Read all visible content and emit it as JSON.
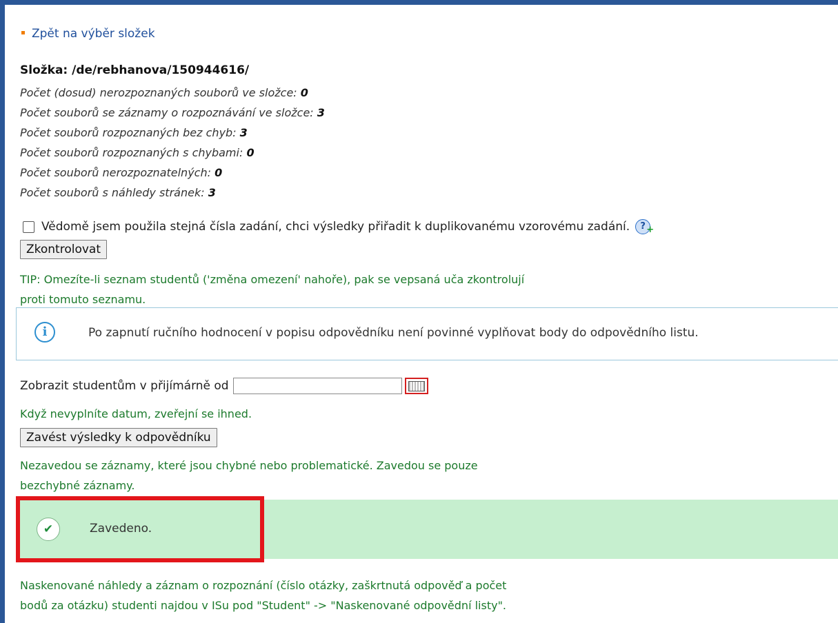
{
  "nav": {
    "back_label": "Zpět na výběr složek"
  },
  "folder": {
    "title": "Složka: /de/rebhanova/150944616/",
    "stats": [
      {
        "label": "Počet (dosud) nerozpoznaných souborů ve složce: ",
        "value": "0"
      },
      {
        "label": "Počet souborů se záznamy o rozpoznávání ve složce: ",
        "value": "3"
      },
      {
        "label": "Počet souborů rozpoznaných bez chyb: ",
        "value": "3"
      },
      {
        "label": "Počet souborů rozpoznaných s chybami: ",
        "value": "0"
      },
      {
        "label": "Počet souborů nerozpoznatelných: ",
        "value": "0"
      },
      {
        "label": "Počet souborů s náhledy stránek: ",
        "value": "3"
      }
    ]
  },
  "duplicate_check": {
    "label": "Vědomě jsem použila stejná čísla zadání, chci výsledky přiřadit k duplikovanému vzorovému zadání.",
    "help_icon_glyph": "?",
    "checked": false
  },
  "check_button": {
    "label": "Zkontrolovat"
  },
  "tip": {
    "line1": "TIP: Omezíte-li seznam studentů ('změna omezení' nahoře), pak se vepsaná uča zkontrolují",
    "line2": "proti tomuto seznamu."
  },
  "info_box": {
    "icon_glyph": "i",
    "text": "Po zapnutí ručního hodnocení v popisu odpovědníku není povinné vyplňovat body do odpovědního listu."
  },
  "publish": {
    "label": "Zobrazit studentům v přijímárně od",
    "date_value": "",
    "hint": "Když nevyplníte datum, zveřejní se ihned."
  },
  "import_button": {
    "label": "Zavést výsledky k odpovědníku"
  },
  "import_note": {
    "line1": "Nezavedou se záznamy, které jsou chybné nebo problematické. Zavedou se pouze",
    "line2": "bezchybné záznamy."
  },
  "success": {
    "icon_glyph": "✔",
    "text": "Zavedeno."
  },
  "footer_note": {
    "line1": "Naskenované náhledy a záznam o rozpoznání (číslo otázky, zaškrtnutá odpověď a počet",
    "line2": "bodů za otázku) studenti najdou v ISu pod \"Student\" -> \"Naskenované odpovědní listy\"."
  },
  "colors": {
    "frame": "#2b5797",
    "link": "#1f4f9c",
    "hint_green": "#1c7a2c",
    "success_bg": "#c6efcf",
    "highlight_red": "#e3161b",
    "info_border": "#9cc8dc"
  }
}
